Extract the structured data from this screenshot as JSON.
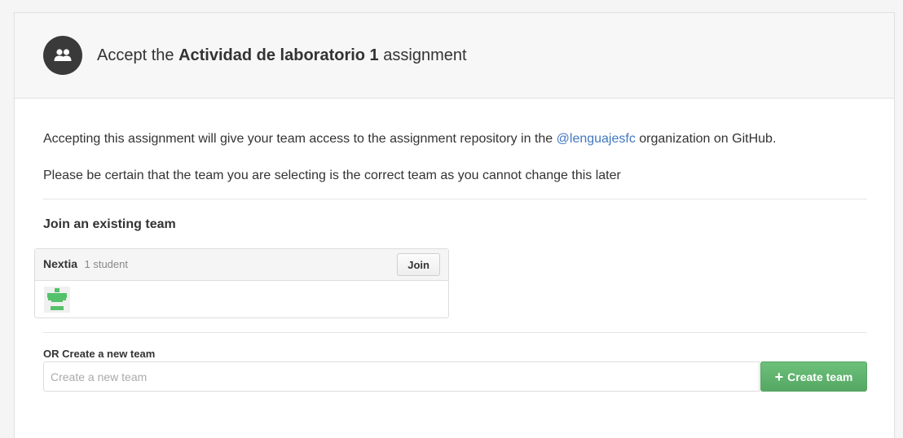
{
  "header": {
    "title_prefix": "Accept the",
    "assignment_name": "Actividad de laboratorio 1",
    "title_suffix": "assignment",
    "avatar_icon": "team-icon"
  },
  "intro": {
    "text_before_link": "Accepting this assignment will give your team access to the assignment repository in the",
    "org_link": "@lenguajesfc",
    "text_after_link": "organization on GitHub.",
    "warning": "Please be certain that the team you are selecting is the correct team as you cannot change this later"
  },
  "join": {
    "heading": "Join an existing team",
    "teams": [
      {
        "name": "Nextia",
        "count": "1 student",
        "button_label": "Join"
      }
    ]
  },
  "create": {
    "label": "OR Create a new team",
    "placeholder": "Create a new team",
    "value": "",
    "button_label": "Create team",
    "button_icon": "plus-icon"
  },
  "colors": {
    "link": "#4078c0",
    "create_button": "#5cb56a",
    "avatar_bg": "#3a3a3a"
  }
}
